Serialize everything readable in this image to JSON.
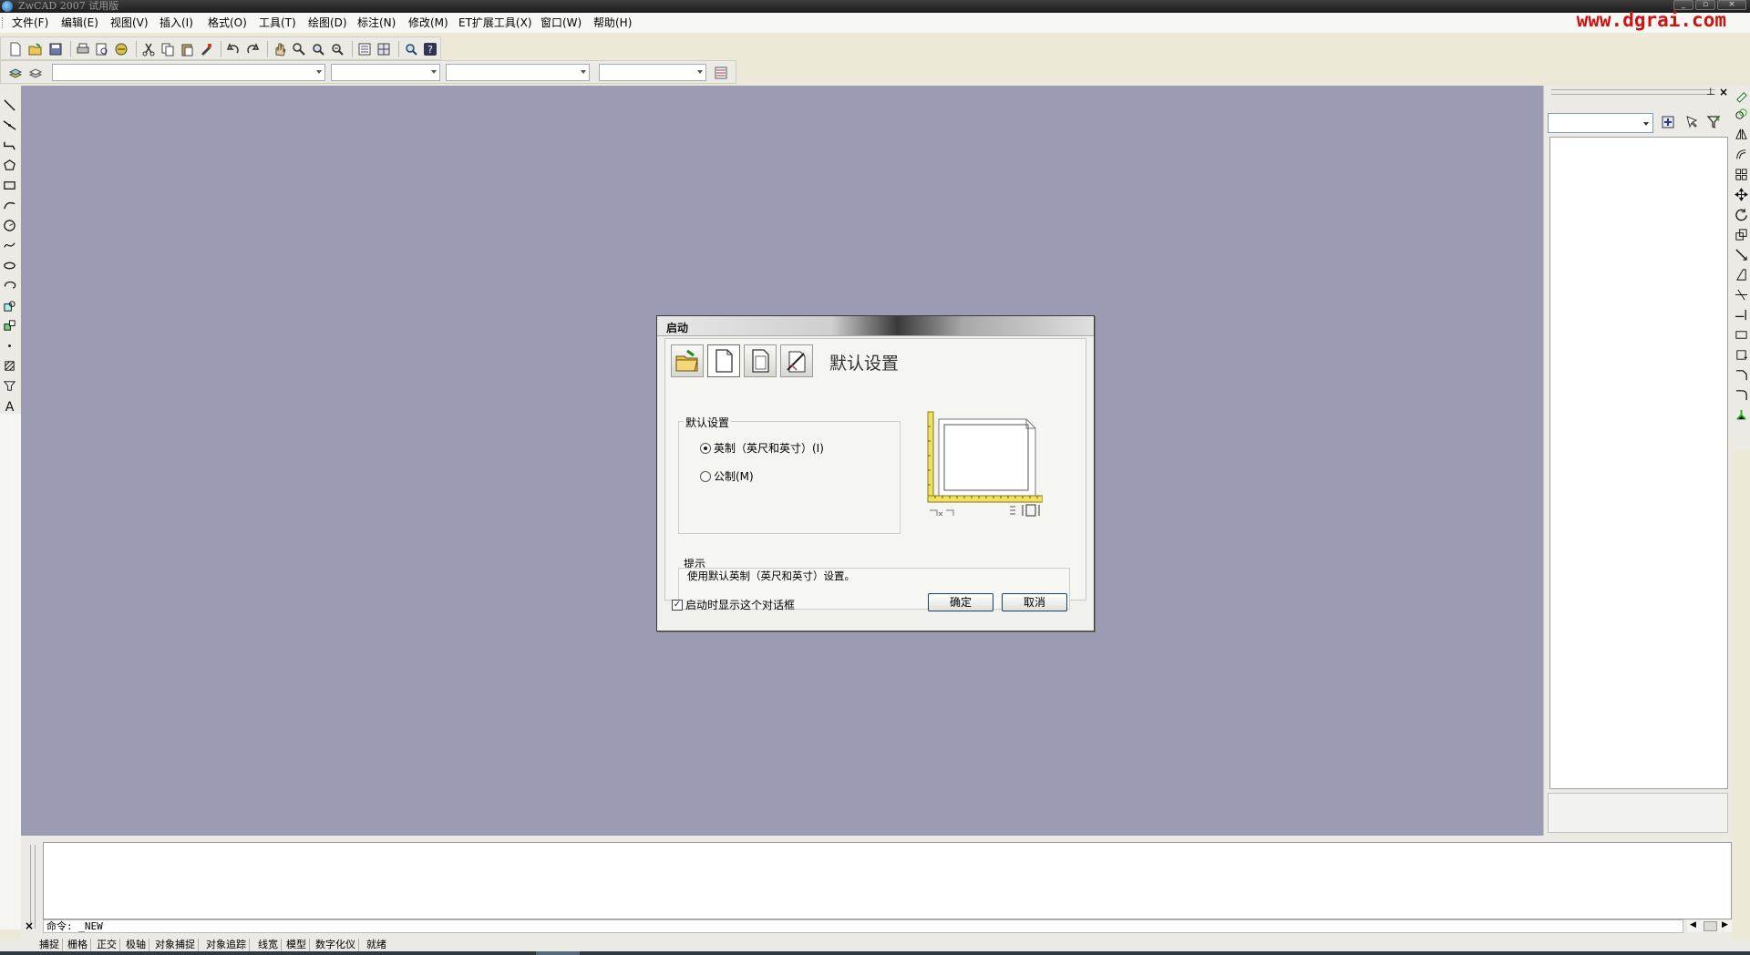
{
  "window": {
    "title": "ZwCAD 2007 试用版"
  },
  "watermark": "www.dgrai.com",
  "menu": [
    "文件(F)",
    "编辑(E)",
    "视图(V)",
    "插入(I)",
    "格式(O)",
    "工具(T)",
    "绘图(D)",
    "标注(N)",
    "修改(M)",
    "ET扩展工具(X)",
    "窗口(W)",
    "帮助(H)"
  ],
  "toolbar_icons": [
    "new-icon",
    "open-icon",
    "save-icon",
    "print-icon",
    "print-preview-icon",
    "publish-icon",
    "cut-icon",
    "copy-icon",
    "paste-icon",
    "match-properties-icon",
    "undo-icon",
    "redo-icon",
    "pan-icon",
    "zoom-realtime-icon",
    "zoom-window-icon",
    "zoom-previous-icon",
    "properties-icon",
    "design-center-icon",
    "find-icon",
    "help-icon"
  ],
  "layer_toolbar": {
    "combos": [
      "",
      "",
      "",
      ""
    ]
  },
  "dialog": {
    "title": "启动",
    "heading": "默认设置",
    "group_label": "默认设置",
    "options": [
      {
        "label": "英制（英尺和英寸）(I)",
        "checked": true
      },
      {
        "label": "公制(M)",
        "checked": false
      }
    ],
    "hint_label": "提示",
    "hint_text": "使用默认英制（英尺和英寸）设置。",
    "show_on_startup": {
      "label": "启动时显示这个对话框",
      "checked": true
    },
    "ok": "确定",
    "cancel": "取消"
  },
  "command": {
    "prompt": "命令: _NEW"
  },
  "status": [
    "捕捉",
    "栅格",
    "正交",
    "极轴",
    "对象捕捉",
    "对象追踪",
    "线宽",
    "模型",
    "数字化仪",
    "就绪"
  ],
  "colors": {
    "canvas": "#9b9cb4",
    "watermark": "#cc1212"
  }
}
